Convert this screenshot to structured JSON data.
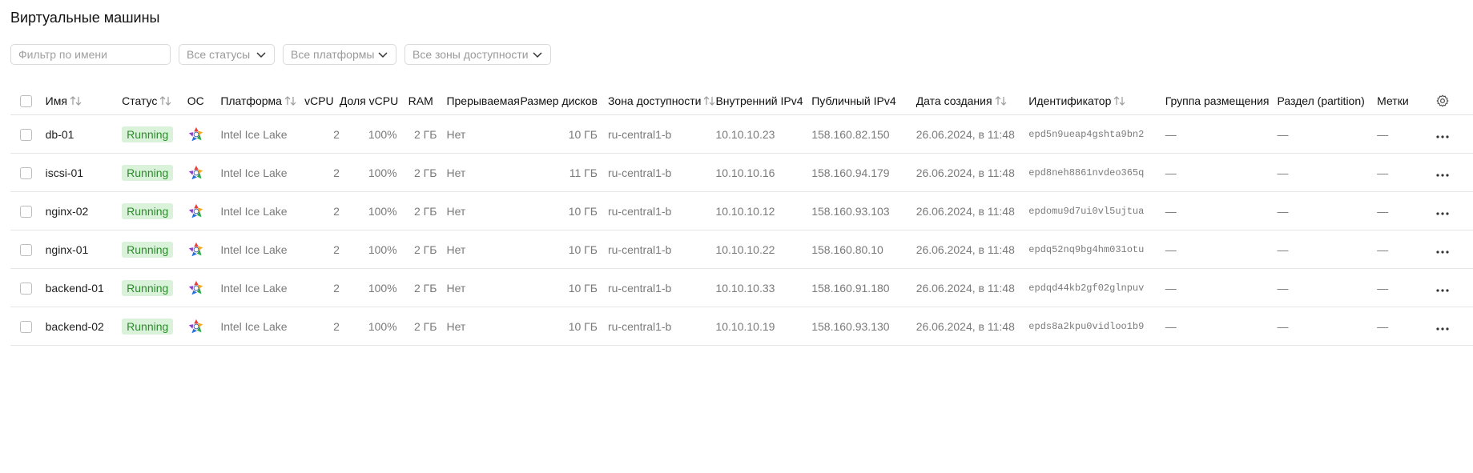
{
  "page": {
    "title": "Виртуальные машины"
  },
  "filters": {
    "name_placeholder": "Фильтр по имени",
    "status_value": "Все статусы",
    "platform_value": "Все платформы",
    "zone_value": "Все зоны доступности"
  },
  "table": {
    "columns": {
      "name": "Имя",
      "status": "Статус",
      "os": "ОС",
      "platform": "Платформа",
      "vcpu": "vCPU",
      "vcpu_share": "Доля vCPU",
      "ram": "RAM",
      "preemptible": "Прерываемая",
      "disk_size": "Размер дисков",
      "zone": "Зона доступности",
      "internal_ipv4": "Внутренний IPv4",
      "public_ipv4": "Публичный IPv4",
      "created": "Дата создания",
      "id": "Идентификатор",
      "placement_group": "Группа размещения",
      "partition": "Раздел (partition)",
      "labels": "Метки"
    },
    "os_icon": "os-logo-icon",
    "rows": [
      {
        "name": "db-01",
        "status": "Running",
        "platform": "Intel Ice Lake",
        "vcpu": "2",
        "vcpu_share": "100%",
        "ram": "2 ГБ",
        "preemptible": "Нет",
        "disk_size": "10 ГБ",
        "zone": "ru-central1-b",
        "internal_ipv4": "10.10.10.23",
        "public_ipv4": "158.160.82.150",
        "created": "26.06.2024, в 11:48",
        "id": "epd5n9ueap4gshta9bn2",
        "placement_group": "—",
        "partition": "—",
        "labels": "—"
      },
      {
        "name": "iscsi-01",
        "status": "Running",
        "platform": "Intel Ice Lake",
        "vcpu": "2",
        "vcpu_share": "100%",
        "ram": "2 ГБ",
        "preemptible": "Нет",
        "disk_size": "11 ГБ",
        "zone": "ru-central1-b",
        "internal_ipv4": "10.10.10.16",
        "public_ipv4": "158.160.94.179",
        "created": "26.06.2024, в 11:48",
        "id": "epd8neh8861nvdeo365q",
        "placement_group": "—",
        "partition": "—",
        "labels": "—"
      },
      {
        "name": "nginx-02",
        "status": "Running",
        "platform": "Intel Ice Lake",
        "vcpu": "2",
        "vcpu_share": "100%",
        "ram": "2 ГБ",
        "preemptible": "Нет",
        "disk_size": "10 ГБ",
        "zone": "ru-central1-b",
        "internal_ipv4": "10.10.10.12",
        "public_ipv4": "158.160.93.103",
        "created": "26.06.2024, в 11:48",
        "id": "epdomu9d7ui0vl5ujtua",
        "placement_group": "—",
        "partition": "—",
        "labels": "—"
      },
      {
        "name": "nginx-01",
        "status": "Running",
        "platform": "Intel Ice Lake",
        "vcpu": "2",
        "vcpu_share": "100%",
        "ram": "2 ГБ",
        "preemptible": "Нет",
        "disk_size": "10 ГБ",
        "zone": "ru-central1-b",
        "internal_ipv4": "10.10.10.22",
        "public_ipv4": "158.160.80.10",
        "created": "26.06.2024, в 11:48",
        "id": "epdq52nq9bg4hm031otu",
        "placement_group": "—",
        "partition": "—",
        "labels": "—"
      },
      {
        "name": "backend-01",
        "status": "Running",
        "platform": "Intel Ice Lake",
        "vcpu": "2",
        "vcpu_share": "100%",
        "ram": "2 ГБ",
        "preemptible": "Нет",
        "disk_size": "10 ГБ",
        "zone": "ru-central1-b",
        "internal_ipv4": "10.10.10.33",
        "public_ipv4": "158.160.91.180",
        "created": "26.06.2024, в 11:48",
        "id": "epdqd44kb2gf02glnpuv",
        "placement_group": "—",
        "partition": "—",
        "labels": "—"
      },
      {
        "name": "backend-02",
        "status": "Running",
        "platform": "Intel Ice Lake",
        "vcpu": "2",
        "vcpu_share": "100%",
        "ram": "2 ГБ",
        "preemptible": "Нет",
        "disk_size": "10 ГБ",
        "zone": "ru-central1-b",
        "internal_ipv4": "10.10.10.19",
        "public_ipv4": "158.160.93.130",
        "created": "26.06.2024, в 11:48",
        "id": "epds8a2kpu0vidloo1b9",
        "placement_group": "—",
        "partition": "—",
        "labels": "—"
      }
    ]
  },
  "colors": {
    "status_badge_bg": "#d9f2d9",
    "status_badge_text": "#2f8a2f"
  }
}
